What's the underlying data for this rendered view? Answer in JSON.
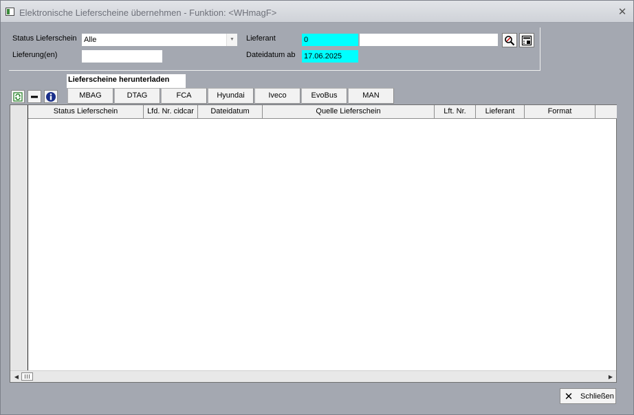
{
  "window": {
    "title": "Elektronische Lieferscheine übernehmen - Funktion: <WHmagF>",
    "icon": "app-window-icon",
    "close_icon": "close-x-icon"
  },
  "filters": {
    "status_label": "Status Lieferschein",
    "status_value": "Alle",
    "lieferungen_label": "Lieferung(en)",
    "lieferungen_value": "",
    "lieferant_label": "Lieferant",
    "lieferant_code": "0",
    "lieferant_name": "",
    "dateidatum_label": "Dateidatum ab",
    "dateidatum_value": "17.06.2025",
    "search_icon": "search-magnifier-icon",
    "calendar_icon": "calculator-icon",
    "highlight_color": "#00ffff"
  },
  "tab": {
    "title": "Lieferscheine herunterladen"
  },
  "toolbar": {
    "icons": [
      "refresh-icon",
      "minus-icon",
      "info-icon"
    ]
  },
  "manufacturers": [
    "MBAG",
    "DTAG",
    "FCA",
    "Hyundai",
    "Iveco",
    "EvoBus",
    "MAN"
  ],
  "grid": {
    "columns": [
      "Status Lieferschein",
      "Lfd. Nr. cidcar",
      "Dateidatum",
      "Quelle Lieferschein",
      "Lft. Nr.",
      "Lieferant",
      "Format"
    ],
    "rows": []
  },
  "footer": {
    "close_label": "Schließen",
    "close_icon": "close-x-icon"
  }
}
